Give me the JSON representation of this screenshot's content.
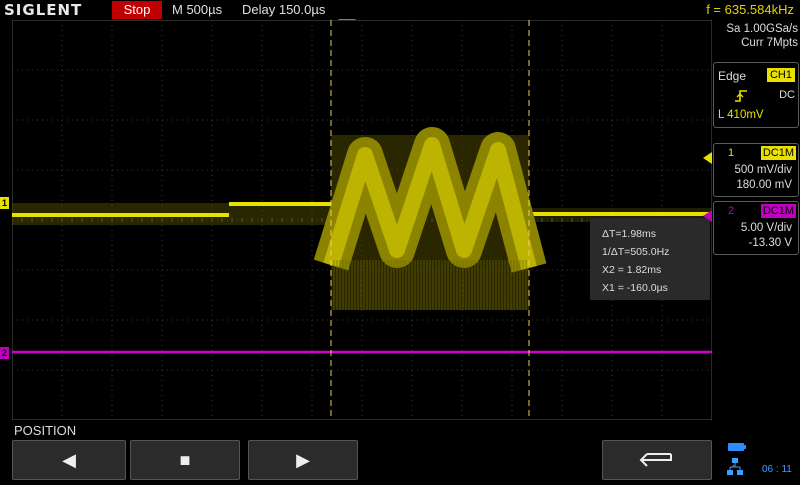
{
  "header": {
    "brand": "SIGLENT",
    "run_state": "Stop",
    "timebase": "M 500µs",
    "delay": "Delay 150.0µs",
    "frequency": "f = 635.584kHz"
  },
  "acquisition": {
    "sample_rate": "Sa 1.00GSa/s",
    "memory_depth": "Curr 7Mpts"
  },
  "trigger": {
    "type": "Edge",
    "source": "CH1",
    "coupling": "DC",
    "level": "L  410mV"
  },
  "channels": [
    {
      "number": "1",
      "coupling": "DC1M",
      "scale": "500 mV/div",
      "offset": "180.00 mV",
      "color": "#e8e000"
    },
    {
      "number": "2",
      "coupling": "DC1M",
      "scale": "5.00 V/div",
      "offset": "-13.30 V",
      "color": "#c000c0"
    }
  ],
  "cursor_readout": {
    "delta_t": "ΔT=1.98ms",
    "inv_delta_t": "1/ΔT=505.0Hz",
    "x2": "X2 = 1.82ms",
    "x1": "X1 = -160.0µs"
  },
  "softkeys": {
    "section_label": "POSITION",
    "left_symbol": "◀",
    "stop_symbol": "■",
    "right_symbol": "▶",
    "back_symbol": "⮌"
  },
  "status_bar": {
    "clock": "06 : 11"
  },
  "channel_markers": {
    "ch1": "1",
    "ch2": "2"
  }
}
